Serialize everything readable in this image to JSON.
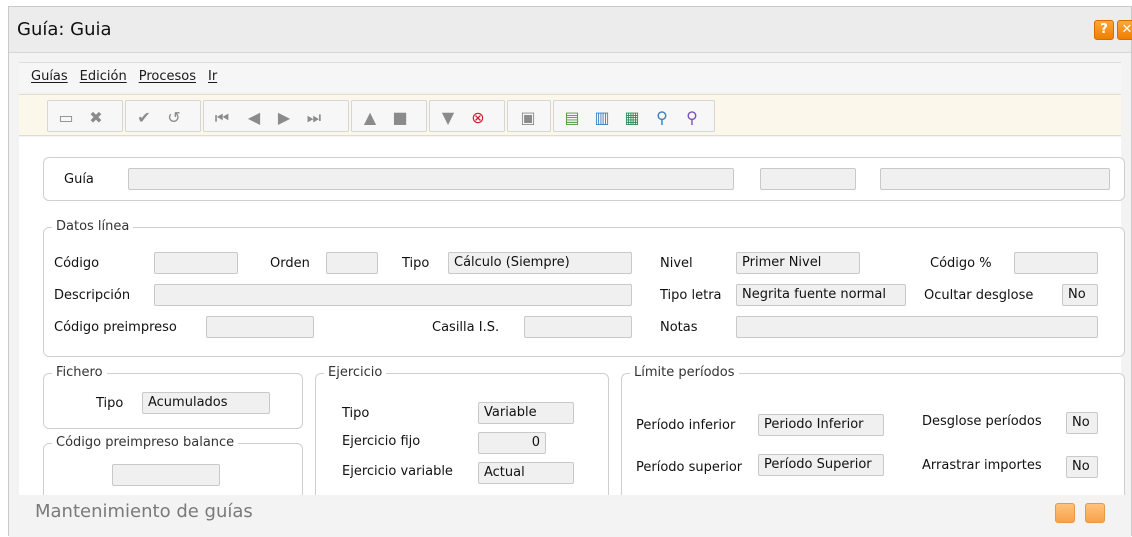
{
  "window": {
    "title": "Guía: Guia",
    "help_label": "?",
    "close_label": "✕",
    "status": "Mantenimiento de guías"
  },
  "menu": {
    "items": [
      "Guías",
      "Edición",
      "Procesos",
      "Ir"
    ]
  },
  "toolbar": {
    "icons": [
      "new-icon",
      "delete-icon",
      "accept-icon",
      "undo-icon",
      "first-icon",
      "previous-icon",
      "next-icon",
      "last-icon",
      "home-icon",
      "stop-icon",
      "filter-icon",
      "clear-filter-icon",
      "note-icon",
      "export-icon",
      "import-icon",
      "excel-icon",
      "search-icon",
      "search-advanced-icon"
    ]
  },
  "guia": {
    "label": "Guía",
    "value": "",
    "value2": "",
    "value3": ""
  },
  "datos_linea": {
    "legend": "Datos línea",
    "codigo_label": "Código",
    "codigo_value": "",
    "orden_label": "Orden",
    "orden_value": "",
    "tipo_label": "Tipo",
    "tipo_value": "Cálculo (Siempre)",
    "nivel_label": "Nivel",
    "nivel_value": "Primer Nivel",
    "codigo_pct_label": "Código %",
    "codigo_pct_value": "",
    "descripcion_label": "Descripción",
    "descripcion_value": "",
    "tipo_letra_label": "Tipo letra",
    "tipo_letra_value": "Negrita fuente normal",
    "ocultar_label": "Ocultar desglose",
    "ocultar_value": "No",
    "preimpreso_label": "Código preimpreso",
    "preimpreso_value": "",
    "casilla_label": "Casilla I.S.",
    "casilla_value": "",
    "notas_label": "Notas",
    "notas_value": ""
  },
  "fichero": {
    "legend": "Fichero",
    "tipo_label": "Tipo",
    "tipo_value": "Acumulados"
  },
  "preimpreso_balance": {
    "legend": "Código preimpreso balance",
    "value": ""
  },
  "ejercicio": {
    "legend": "Ejercicio",
    "tipo_label": "Tipo",
    "tipo_value": "Variable",
    "fijo_label": "Ejercicio fijo",
    "fijo_value": "0",
    "variable_label": "Ejercicio variable",
    "variable_value": "Actual"
  },
  "limite": {
    "legend": "Límite períodos",
    "inferior_label": "Período inferior",
    "inferior_value": "Periodo Inferior",
    "superior_label": "Período superior",
    "superior_value": "Período Superior",
    "desglose_label": "Desglose períodos",
    "desglose_value": "No",
    "arrastrar_label": "Arrastrar importes",
    "arrastrar_value": "No"
  }
}
